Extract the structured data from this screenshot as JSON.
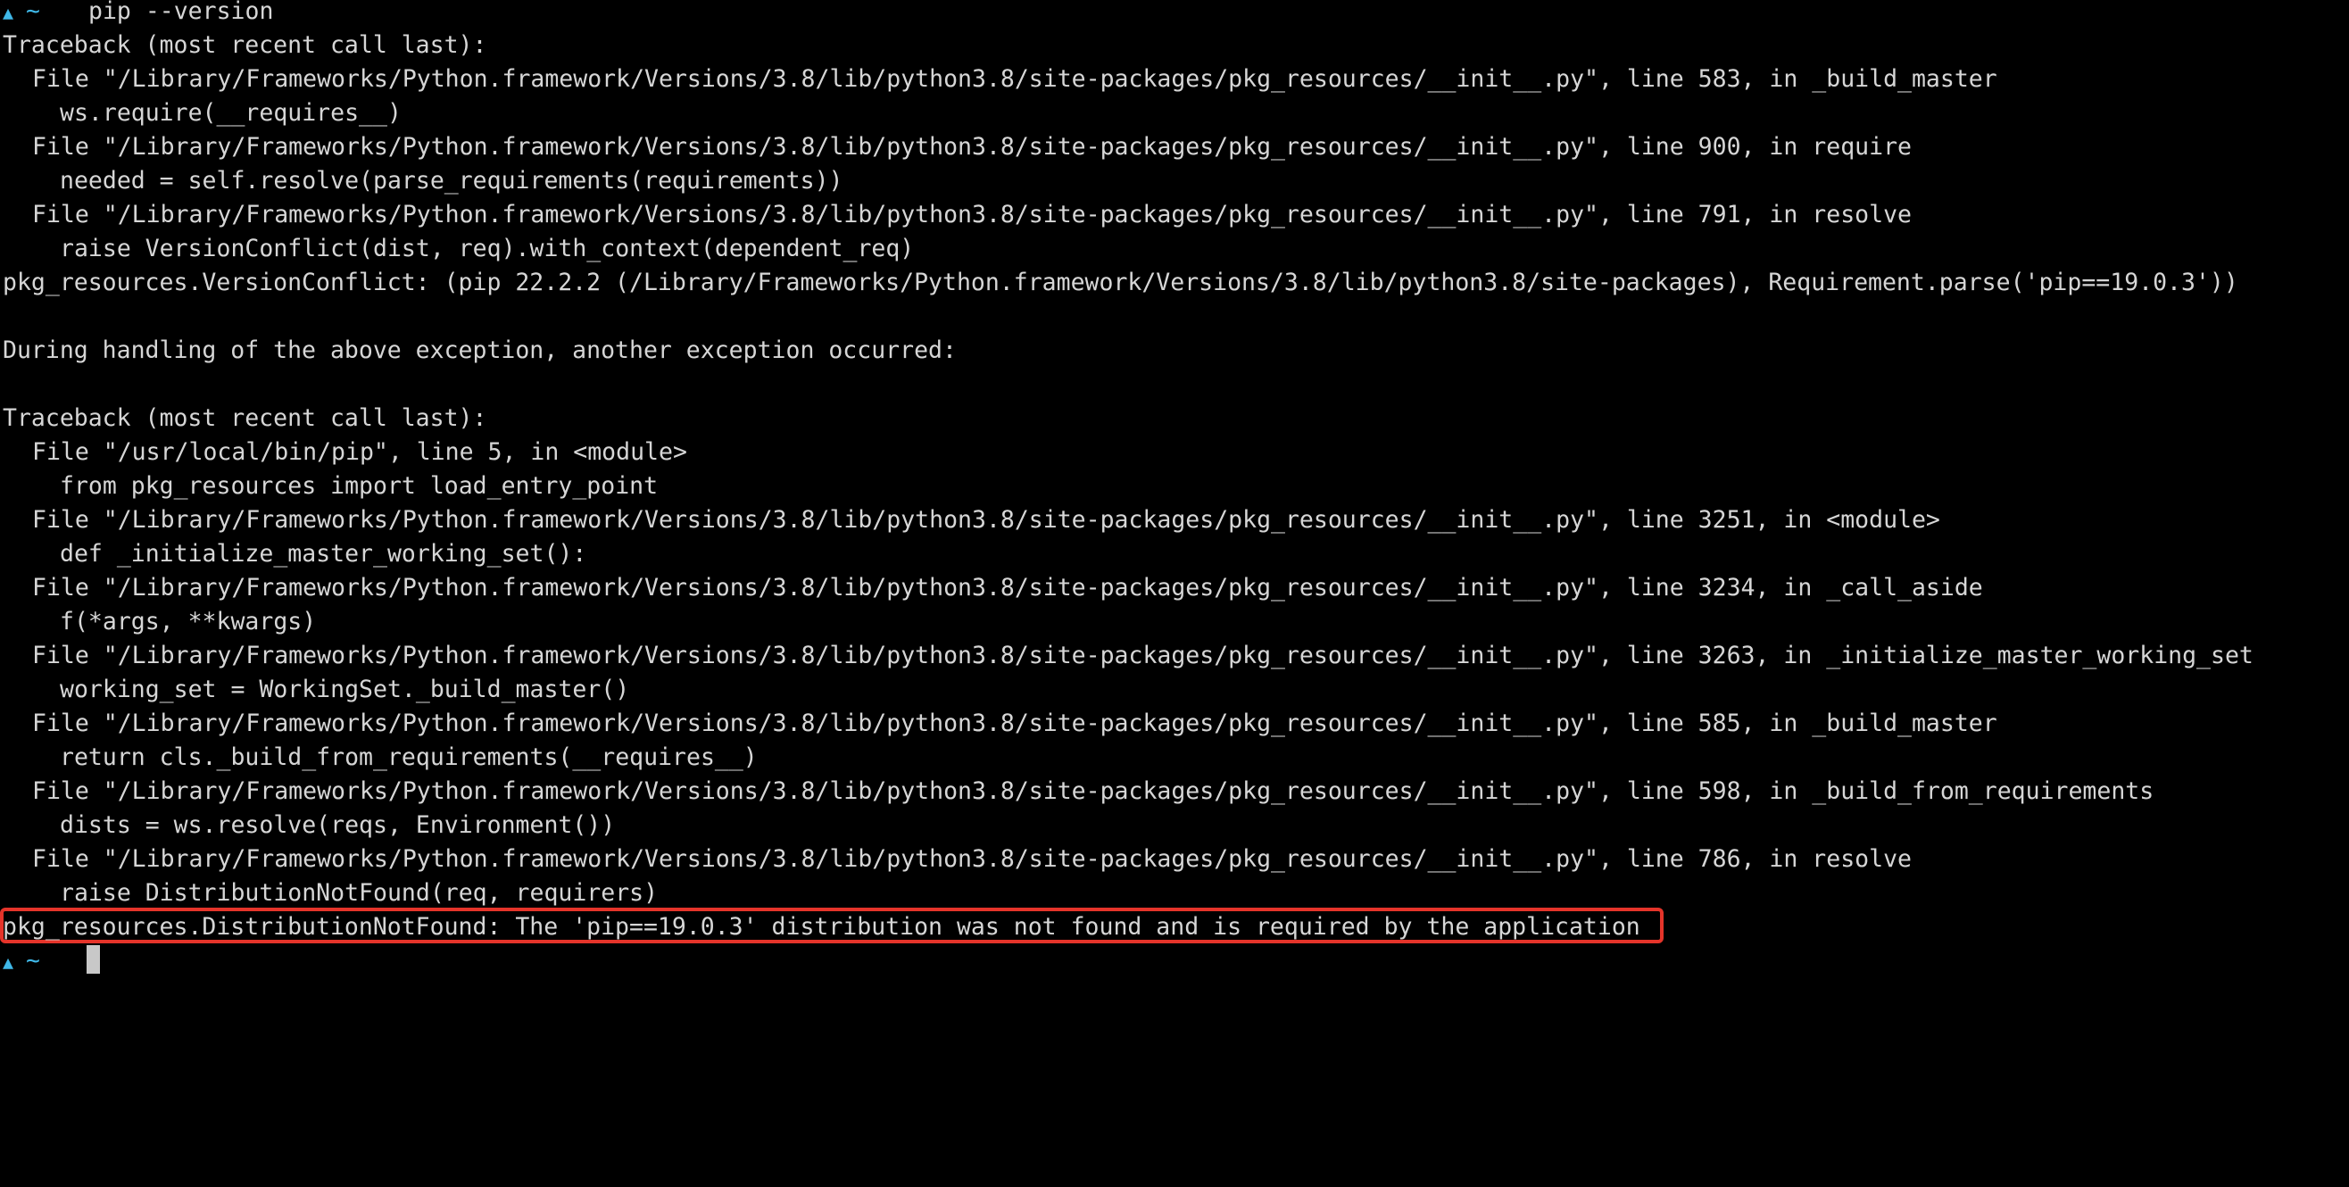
{
  "terminal": {
    "prompt_symbol": "▲",
    "prompt_dir": "~",
    "command": "pip --version",
    "lines": [
      "Traceback (most recent call last):",
      "File \"/Library/Frameworks/Python.framework/Versions/3.8/lib/python3.8/site-packages/pkg_resources/__init__.py\", line 583, in _build_master",
      "ws.require(__requires__)",
      "File \"/Library/Frameworks/Python.framework/Versions/3.8/lib/python3.8/site-packages/pkg_resources/__init__.py\", line 900, in require",
      "needed = self.resolve(parse_requirements(requirements))",
      "File \"/Library/Frameworks/Python.framework/Versions/3.8/lib/python3.8/site-packages/pkg_resources/__init__.py\", line 791, in resolve",
      "raise VersionConflict(dist, req).with_context(dependent_req)",
      "pkg_resources.VersionConflict: (pip 22.2.2 (/Library/Frameworks/Python.framework/Versions/3.8/lib/python3.8/site-packages), Requirement.parse('pip==19.0.3'))",
      "During handling of the above exception, another exception occurred:",
      "Traceback (most recent call last):",
      "File \"/usr/local/bin/pip\", line 5, in <module>",
      "from pkg_resources import load_entry_point",
      "File \"/Library/Frameworks/Python.framework/Versions/3.8/lib/python3.8/site-packages/pkg_resources/__init__.py\", line 3251, in <module>",
      "def _initialize_master_working_set():",
      "File \"/Library/Frameworks/Python.framework/Versions/3.8/lib/python3.8/site-packages/pkg_resources/__init__.py\", line 3234, in _call_aside",
      "f(*args, **kwargs)",
      "File \"/Library/Frameworks/Python.framework/Versions/3.8/lib/python3.8/site-packages/pkg_resources/__init__.py\", line 3263, in _initialize_master_working_set",
      "working_set = WorkingSet._build_master()",
      "File \"/Library/Frameworks/Python.framework/Versions/3.8/lib/python3.8/site-packages/pkg_resources/__init__.py\", line 585, in _build_master",
      "return cls._build_from_requirements(__requires__)",
      "File \"/Library/Frameworks/Python.framework/Versions/3.8/lib/python3.8/site-packages/pkg_resources/__init__.py\", line 598, in _build_from_requirements",
      "dists = ws.resolve(reqs, Environment())",
      "File \"/Library/Frameworks/Python.framework/Versions/3.8/lib/python3.8/site-packages/pkg_resources/__init__.py\", line 786, in resolve",
      "raise DistributionNotFound(req, requirers)",
      "pkg_resources.DistributionNotFound: The 'pip==19.0.3' distribution was not found and is required by the application"
    ]
  },
  "colors": {
    "background": "#000000",
    "text": "#d6d6d6",
    "prompt": "#3fb8e8",
    "highlight_border": "#e5342a"
  }
}
